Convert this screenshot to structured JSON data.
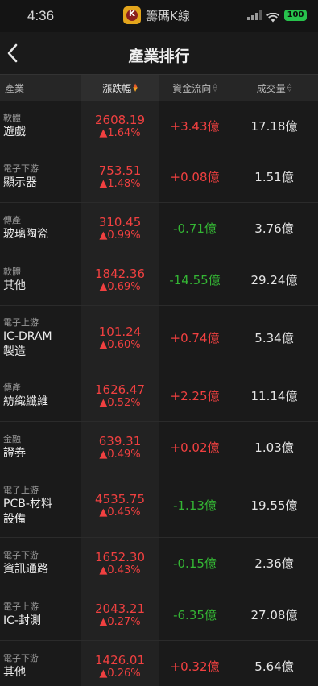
{
  "status": {
    "time": "4:36",
    "app_name": "籌碼K線",
    "app_logo_letter": "K",
    "battery": "100"
  },
  "nav": {
    "title": "產業排行"
  },
  "header": {
    "industry": "產業",
    "change": "漲跌幅",
    "flow": "資金流向",
    "volume": "成交量"
  },
  "colors": {
    "up": "#f04040",
    "down": "#34b534",
    "battery": "#27c24c"
  },
  "rows": [
    {
      "category": "軟體",
      "name": "遊戲",
      "price": "2608.19",
      "pct": "▲1.64%",
      "flow": "+3.43億",
      "flow_dir": "pos",
      "volume": "17.18億"
    },
    {
      "category": "電子下游",
      "name": "顯示器",
      "price": "753.51",
      "pct": "▲1.48%",
      "flow": "+0.08億",
      "flow_dir": "pos",
      "volume": "1.51億"
    },
    {
      "category": "傳產",
      "name": "玻璃陶瓷",
      "price": "310.45",
      "pct": "▲0.99%",
      "flow": "-0.71億",
      "flow_dir": "neg",
      "volume": "3.76億"
    },
    {
      "category": "軟體",
      "name": "其他",
      "price": "1842.36",
      "pct": "▲0.69%",
      "flow": "-14.55億",
      "flow_dir": "neg",
      "volume": "29.24億"
    },
    {
      "category": "電子上游",
      "name": "IC-DRAM\n製造",
      "price": "101.24",
      "pct": "▲0.60%",
      "flow": "+0.74億",
      "flow_dir": "pos",
      "volume": "5.34億"
    },
    {
      "category": "傳產",
      "name": "紡織纖維",
      "price": "1626.47",
      "pct": "▲0.52%",
      "flow": "+2.25億",
      "flow_dir": "pos",
      "volume": "11.14億"
    },
    {
      "category": "金融",
      "name": "證券",
      "price": "639.31",
      "pct": "▲0.49%",
      "flow": "+0.02億",
      "flow_dir": "pos",
      "volume": "1.03億"
    },
    {
      "category": "電子上游",
      "name": "PCB-材料\n設備",
      "price": "4535.75",
      "pct": "▲0.45%",
      "flow": "-1.13億",
      "flow_dir": "neg",
      "volume": "19.55億"
    },
    {
      "category": "電子下游",
      "name": "資訊通路",
      "price": "1652.30",
      "pct": "▲0.43%",
      "flow": "-0.15億",
      "flow_dir": "neg",
      "volume": "2.36億"
    },
    {
      "category": "電子上游",
      "name": "IC-封測",
      "price": "2043.21",
      "pct": "▲0.27%",
      "flow": "-6.35億",
      "flow_dir": "neg",
      "volume": "27.08億"
    },
    {
      "category": "電子下游",
      "name": "其他",
      "price": "1426.01",
      "pct": "▲0.26%",
      "flow": "+0.32億",
      "flow_dir": "pos",
      "volume": "5.64億"
    }
  ]
}
